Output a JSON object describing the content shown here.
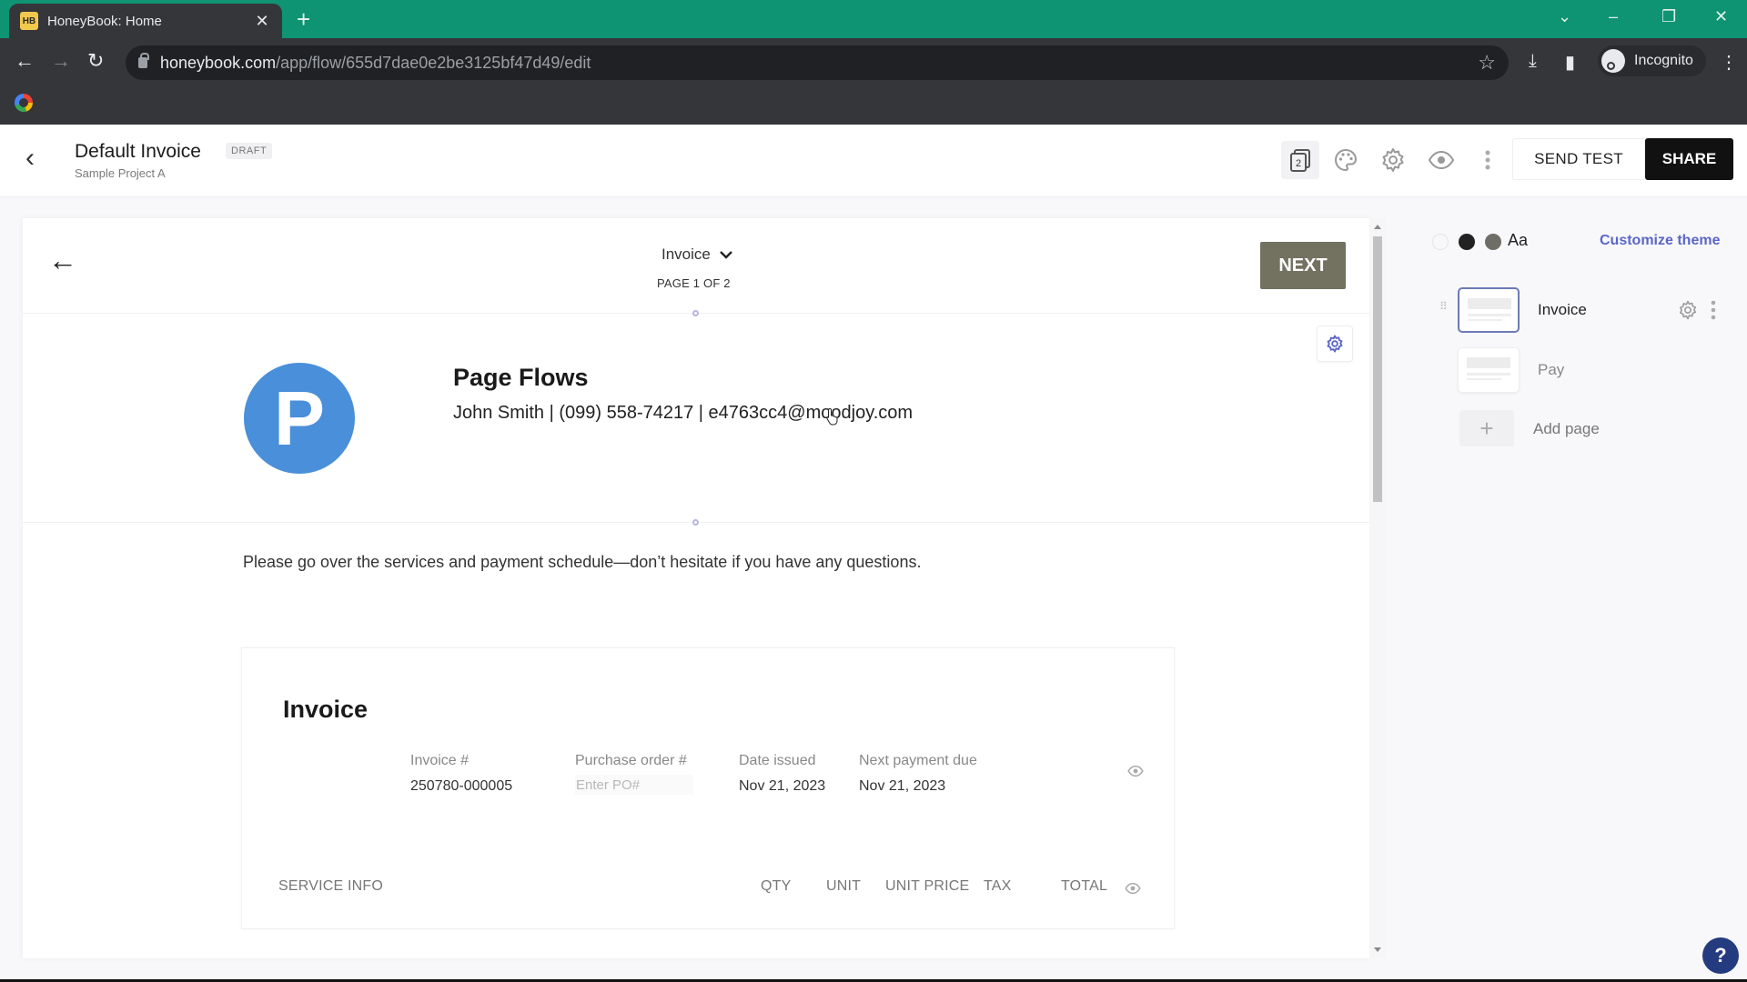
{
  "browser": {
    "tab_title": "HoneyBook: Home",
    "tab_favicon": "HB",
    "url_host": "honeybook.com",
    "url_path": "/app/flow/655d7dae0e2be3125bf47d49/edit",
    "profile_label": "Incognito",
    "colors": {
      "tabbar": "#0e9373",
      "toolbar": "#35363a"
    }
  },
  "header": {
    "title": "Default Invoice",
    "status_badge": "DRAFT",
    "subtitle": "Sample Project A",
    "pages_count": "2",
    "send_test_label": "SEND TEST",
    "share_label": "SHARE"
  },
  "canvas": {
    "page_selector": "Invoice",
    "page_indicator": "PAGE 1 OF 2",
    "next_label": "NEXT",
    "next_color": "#737160",
    "logo_letter": "P",
    "logo_color": "#4a8fd9",
    "company_name": "Page Flows",
    "contact_line": "John Smith | (099) 558-74217 | e4763cc4@moodjoy.com",
    "intro_text": "Please go over the services and payment schedule—don’t hesitate if you have any questions.",
    "invoice": {
      "title": "Invoice",
      "fields": [
        {
          "label": "Invoice #",
          "value": "250780-000005"
        },
        {
          "label": "Purchase order #",
          "placeholder": "Enter PO#",
          "value": ""
        },
        {
          "label": "Date issued",
          "value": "Nov 21, 2023"
        },
        {
          "label": "Next payment due",
          "value": "Nov 21, 2023"
        }
      ],
      "columns": [
        "SERVICE INFO",
        "QTY",
        "UNIT",
        "UNIT PRICE",
        "TAX",
        "TOTAL"
      ]
    }
  },
  "sidebar": {
    "theme_swatches": [
      "#ffffff",
      "#222222",
      "#6f6e66"
    ],
    "font_sample": "Aa",
    "customize_label": "Customize theme",
    "accent": "#5b67c6",
    "pages": [
      {
        "name": "Invoice",
        "active": true
      },
      {
        "name": "Pay",
        "active": false
      }
    ],
    "add_page_label": "Add page"
  },
  "help": {
    "label": "?"
  }
}
